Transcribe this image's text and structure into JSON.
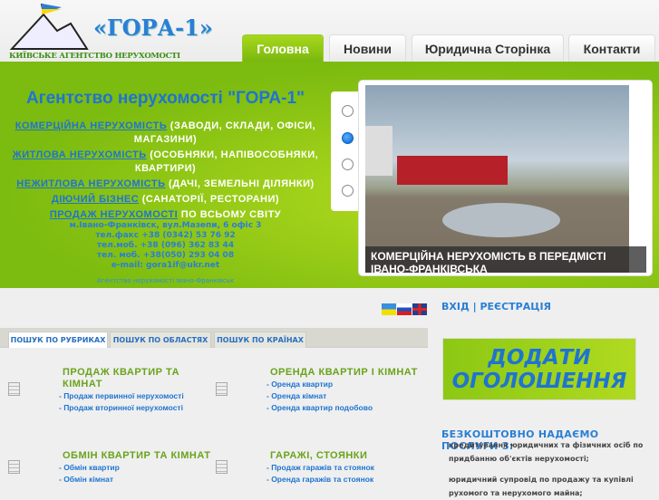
{
  "header": {
    "logo_title": "«ГОРА-1»",
    "logo_subtitle": "КИЇВСЬКЕ АГЕНТСТВО НЕРУХОМОСТІ",
    "nav": [
      "Головна",
      "Новини",
      "Юридична Сторінка",
      "Контакти"
    ]
  },
  "hero": {
    "title": "Агентство нерухомості \"ГОРА-1\"",
    "items": [
      {
        "link": "КОМЕРЦІЙНА НЕРУХОМІСТЬ",
        "text": " (ЗАВОДИ, СКЛАДИ, ОФІСИ, МАГАЗИНИ)"
      },
      {
        "link": "ЖИТЛОВА НЕРУХОМІСТЬ",
        "text": " (ОСОБНЯКИ, НАПІВОСОБНЯКИ, КВАРТИРИ)"
      },
      {
        "link": "НЕЖИТЛОВА НЕРУХОМІСТЬ",
        "text": " (ДАЧІ, ЗЕМЕЛЬНІ ДІЛЯНКИ)"
      },
      {
        "link": "ДІЮЧИЙ БІЗНЕС",
        "text": " (САНАТОРІЇ, РЕСТОРАНИ)"
      },
      {
        "link": "ПРОДАЖ НЕРУХОМОСТІ",
        "text": " ПО ВСЬОМУ СВІТУ"
      }
    ],
    "address": [
      "м.Івано-Франківск, вул.Мазепи, 6 офіс 3",
      "тел.факс +38 (0342) 53 76 92",
      "тел.моб. +38 (096) 362 83 44",
      "тел. моб. +38(050) 293 04 08",
      "e-mail: gora1if@ukr.net"
    ],
    "footer": "Агентство нерухомості Івано-Франківськ"
  },
  "slider": {
    "caption": "КОМЕРЦІЙНА НЕРУХОМІСТЬ В ПЕРЕДМІСТІ ІВАНО-ФРАНКІВСЬКА",
    "active_index": 1,
    "count": 4
  },
  "auth": {
    "login": "ВХІД",
    "separator": " | ",
    "register": "РЕЄСТРАЦІЯ"
  },
  "search_tabs": [
    "ПОШУК ПО РУБРИКАХ",
    "ПОШУК ПО ОБЛАСТЯХ",
    "ПОШУК ПО КРАЇНАХ"
  ],
  "categories": [
    {
      "title": "ПРОДАЖ КВАРТИР ТА КІМНАТ",
      "links": [
        "- Продаж первинної нерухомості",
        "- Продаж вторинної нерухомості"
      ]
    },
    {
      "title": "ОРЕНДА КВАРТИР І КІМНАТ",
      "links": [
        "- Оренда квартир",
        "- Оренда кімнат",
        "- Оренда квартир подобово"
      ]
    },
    {
      "title": "ОБМІН КВАРТИР ТА КІМНАТ",
      "links": [
        "- Обмін квартир",
        "- Обмін кімнат"
      ]
    },
    {
      "title": "ГАРАЖІ, СТОЯНКИ",
      "links": [
        "- Продаж гаражів та стоянок",
        "- Оренда гаражів та стоянок"
      ]
    }
  ],
  "add_ad": [
    "ДОДАТИ",
    "ОГОЛОШЕННЯ"
  ],
  "services": {
    "title": "БЕЗКОШТОВНО НАДАЄМО ПОСЛУГИ З:",
    "items": [
      "кредитування юридичних та фізичних осіб по придбанню об'єктів нерухомості;",
      "юридичний супровід по продажу та купівлі рухомого та нерухомого майна;"
    ]
  }
}
